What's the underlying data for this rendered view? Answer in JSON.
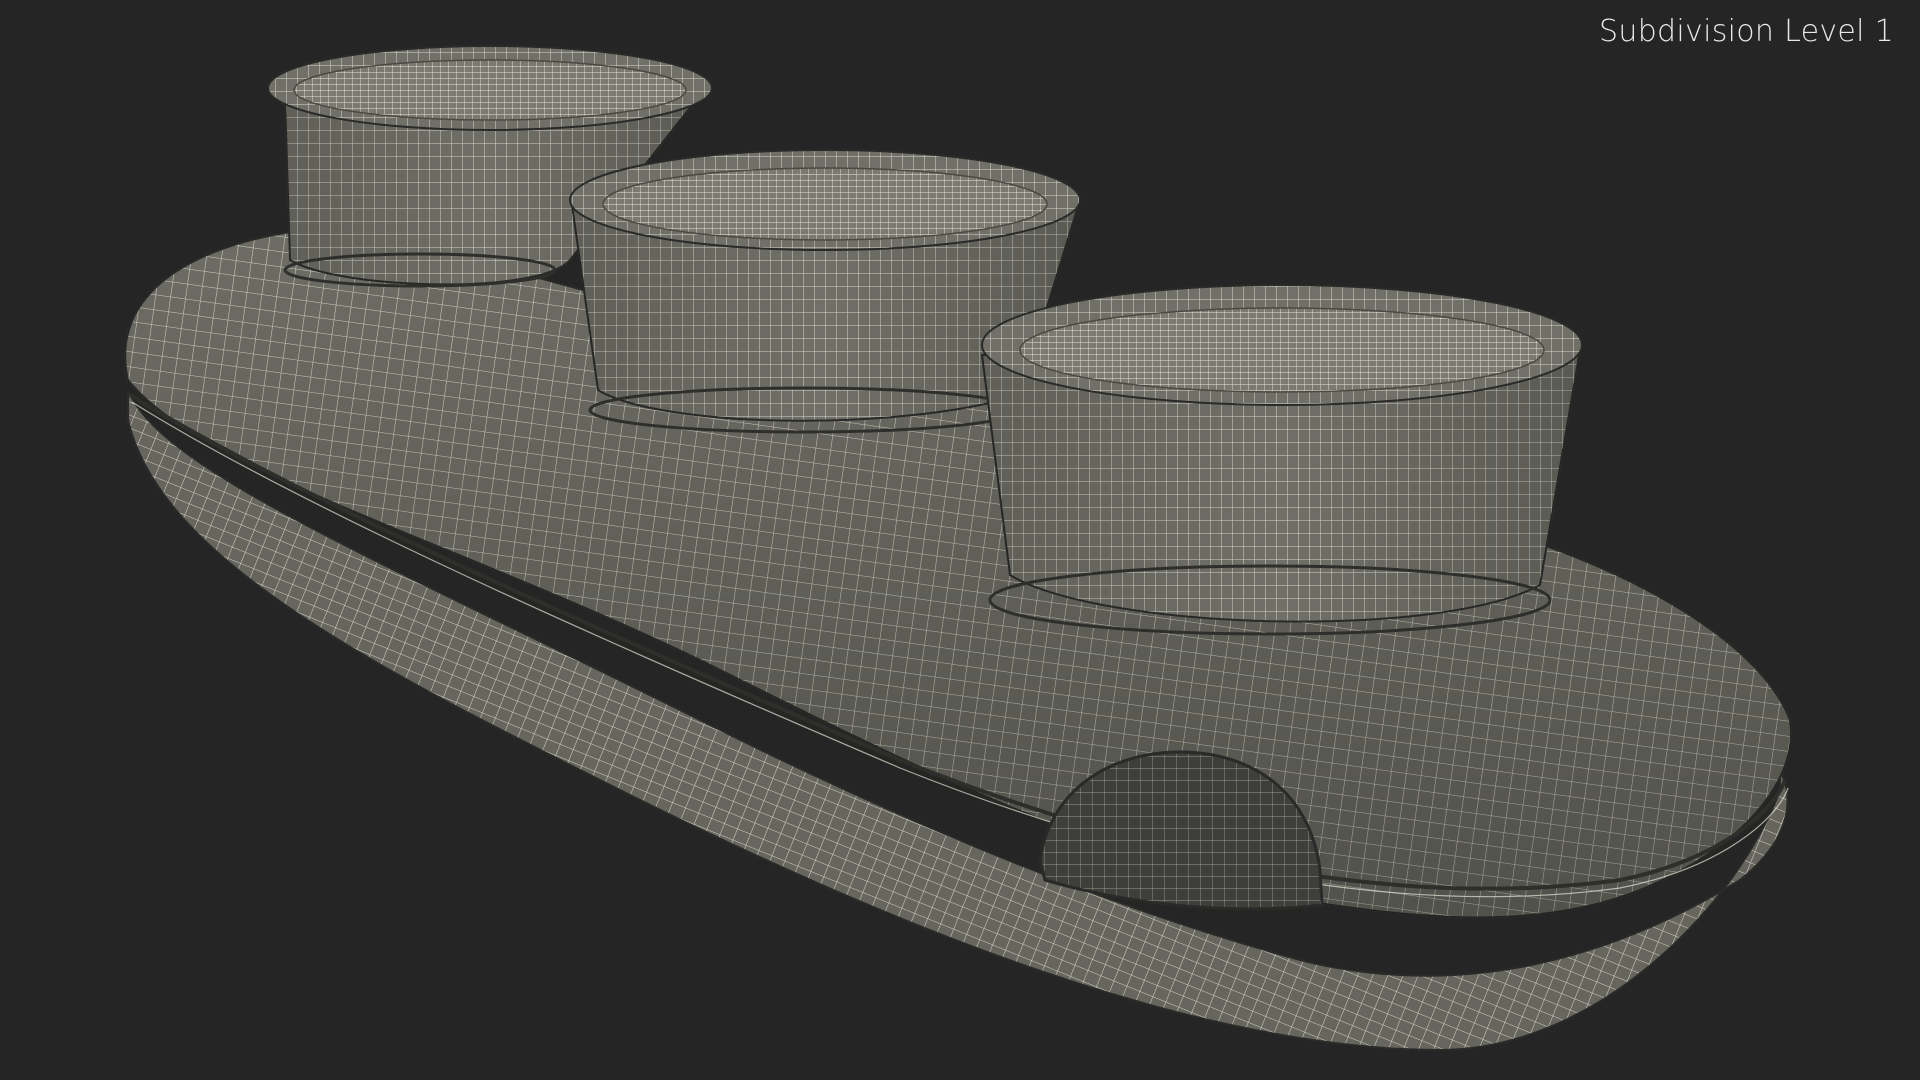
{
  "overlay": {
    "label": "Subdivision Level 1"
  },
  "colors": {
    "background": "#252525",
    "mesh_fill": "#6f6f66",
    "mesh_fill_dark": "#56564f",
    "wire": "#e6e4d6",
    "cavity": "#3b3b37"
  }
}
